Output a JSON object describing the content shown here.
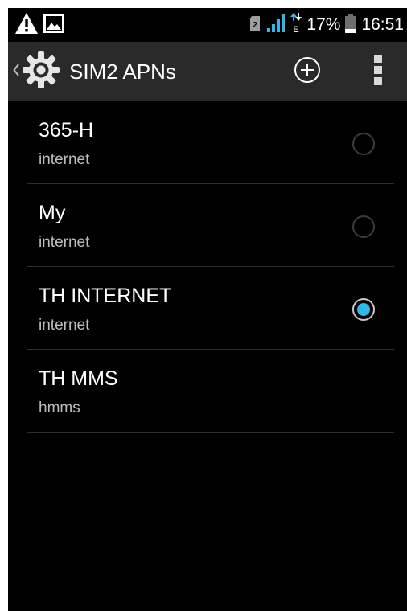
{
  "status_bar": {
    "battery": "17%",
    "time": "16:51"
  },
  "action_bar": {
    "title": "SIM2 APNs"
  },
  "apns": [
    {
      "name": "365-H",
      "apn": "internet",
      "selected": false
    },
    {
      "name": "My",
      "apn": "internet",
      "selected": false
    },
    {
      "name": "TH INTERNET",
      "apn": "internet",
      "selected": true
    },
    {
      "name": "TH MMS",
      "apn": "hmms",
      "selected": false
    }
  ],
  "colors": {
    "accent": "#33b5e5",
    "action_bar_bg": "#2a2a2a",
    "background": "#000000"
  },
  "icons": {
    "status_left": [
      "warning-icon",
      "picture-icon"
    ],
    "status_right": [
      "sim-icon",
      "signal-icon",
      "data-e-icon",
      "battery-icon"
    ],
    "action_bar": [
      "back-caret-icon",
      "settings-gear-icon",
      "add-icon",
      "overflow-menu-icon"
    ]
  }
}
